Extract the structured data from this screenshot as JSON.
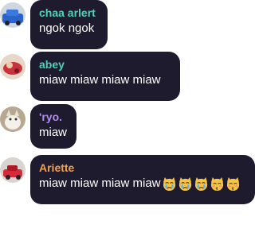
{
  "colors": {
    "bubble_bg": "#1f1b2e",
    "text": "#ffffff"
  },
  "messages": [
    {
      "username": "chaa arlert",
      "username_color": "#4fd1b8",
      "text": "ngok ngok",
      "avatar": "avatar-blue-car"
    },
    {
      "username": "abey",
      "username_color": "#4fd1b8",
      "text": "miaw miaw miaw miaw",
      "avatar": "avatar-red-toy"
    },
    {
      "username": "'ryo.",
      "username_color": "#b48cf0",
      "text": "miaw",
      "avatar": "avatar-cat"
    },
    {
      "username": "Ariette",
      "username_color": "#f0a050",
      "text": "miaw miaw miaw miaw",
      "avatar": "avatar-red-car",
      "emojis": [
        "crying-cat-emoji",
        "crying-cat-emoji",
        "crying-cat-emoji",
        "kissing-cat-emoji",
        "kissing-cat-emoji"
      ]
    }
  ]
}
